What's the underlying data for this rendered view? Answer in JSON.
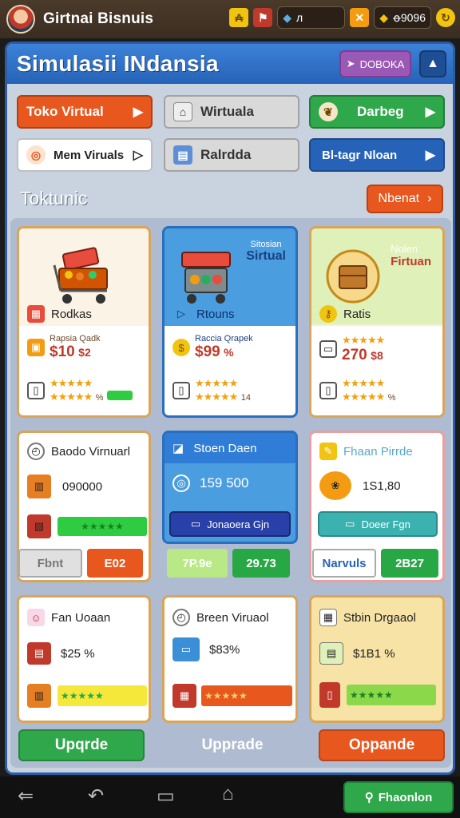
{
  "top_bar": {
    "app_name": "Girtnai Bisnuis",
    "resource_1_value": "л",
    "resource_2_value": "ꝋ9096"
  },
  "panel": {
    "title": "Simulasii INdansia",
    "header_button_label": "DOBOKA"
  },
  "nav_buttons": [
    {
      "label": "Toko Virtual",
      "color": "#e8571e"
    },
    {
      "label": "Wirtuala",
      "color": "#d9d9d9"
    },
    {
      "label": "Darbeg",
      "color": "#2ea84a"
    },
    {
      "label": "Mem Viruals",
      "color": "#ffffff"
    },
    {
      "label": "Ralrdda",
      "color": "#d9d9d9"
    },
    {
      "label": "Bl-tagr Nloan",
      "color": "#2663b8"
    }
  ],
  "section": {
    "title": "Toktunic",
    "more_label": "Nbenat"
  },
  "row1": [
    {
      "item_label": "Rodkas",
      "sub_small": "Rapsia Qadk",
      "price": "$10",
      "price_extra": "$2",
      "stars_extra": "%"
    },
    {
      "top_line_1": "Sitosian",
      "top_line_2": "Sirtual",
      "item_label": "Rtouns",
      "sub_small": "Raccia Qrapek",
      "price": "$99",
      "price_extra": "%",
      "stars_extra": "14"
    },
    {
      "top_line_1": "Nolen",
      "top_line_2": "Firtuan",
      "item_label": "Ratis",
      "sub_small": "",
      "price": "270",
      "price_extra": "$8",
      "stars_extra": "%"
    }
  ],
  "row2": [
    {
      "title": "Baodo Virnuarl",
      "value": "090000",
      "tab_left": "Fbnt",
      "tab_right": "E02"
    },
    {
      "title": "Stoen Daen",
      "value": "159 500",
      "button_label": "Jonaoera Gjn",
      "tab_left": "7P.9e",
      "tab_right": "29.73"
    },
    {
      "title": "Fhaan Pirrde",
      "value": "1S1,80",
      "button_label": "Doeer Fgn",
      "tab_left": "Narvuls",
      "tab_right": "2B27"
    }
  ],
  "row3": [
    {
      "title": "Fan Uoaan",
      "price": "$25 %"
    },
    {
      "title": "Breen Viruaol",
      "price": "$83%"
    },
    {
      "title": "Stbin Drgaaol",
      "price": "$1B1 %"
    }
  ],
  "bottom_buttons": {
    "left": "Upqrde",
    "middle": "Upprade",
    "right": "Oppande"
  },
  "promo_button": "Fhaonlon"
}
